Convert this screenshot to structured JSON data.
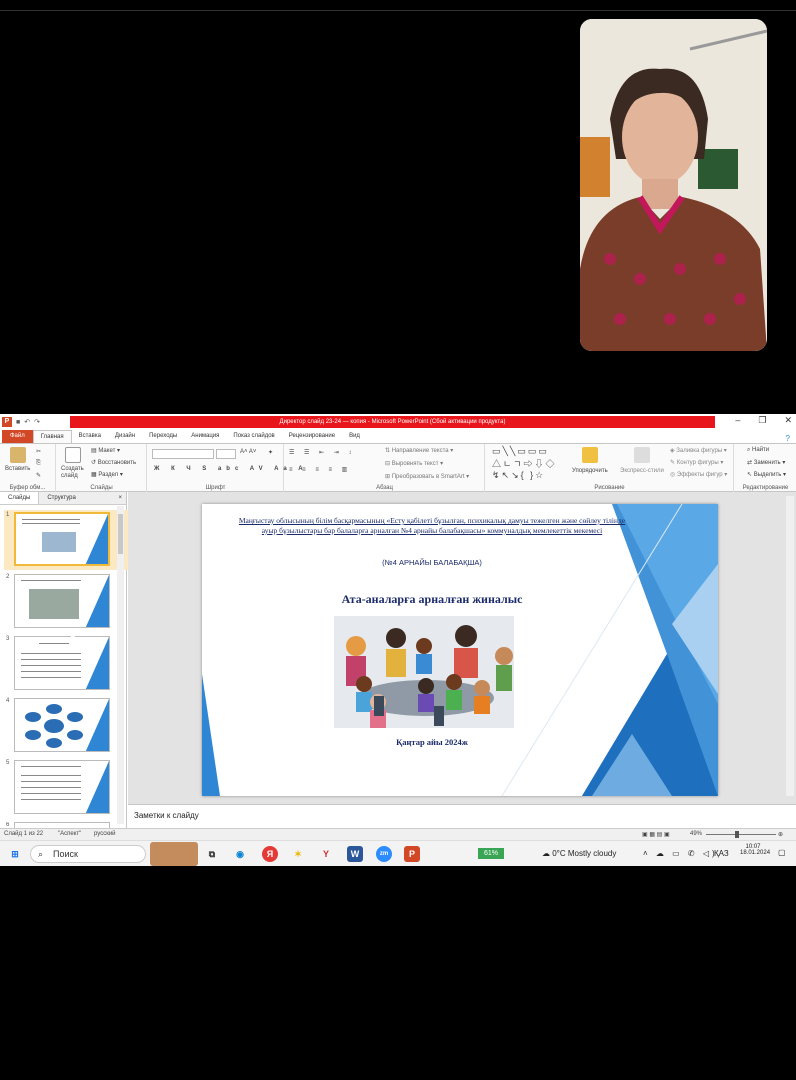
{
  "window": {
    "title": "Директор слайд 23-24 — копия - Microsoft PowerPoint (Сбой активации продукта)",
    "controls": [
      "–",
      "❐",
      "✕"
    ]
  },
  "ribbon_tabs": [
    "Файл",
    "Главная",
    "Вставка",
    "Дизайн",
    "Переходы",
    "Анимация",
    "Показ слайдов",
    "Рецензирование",
    "Вид"
  ],
  "ribbon": {
    "clipboard": {
      "label": "Буфер обм...",
      "paste": "Вставить"
    },
    "slides": {
      "label": "Слайды",
      "new_slide": "Создать слайд",
      "layout": "Макет",
      "reset": "Восстановить",
      "section": "Раздел"
    },
    "font": {
      "label": "Шрифт"
    },
    "paragraph": {
      "label": "Абзац",
      "text_direction": "Направление текста",
      "align_text": "Выровнять текст",
      "smartart": "Преобразовать в SmartArt"
    },
    "drawing": {
      "label": "Рисование",
      "arrange": "Упорядочить",
      "quick_styles": "Экспресс-стили",
      "shape_fill": "Заливка фигуры",
      "shape_outline": "Контур фигуры",
      "shape_effects": "Эффекты фигур"
    },
    "editing": {
      "label": "Редактирование",
      "find": "Найти",
      "replace": "Заменить",
      "select": "Выделить"
    }
  },
  "pane_tabs": {
    "slides": "Слайды",
    "outline": "Структура"
  },
  "thumbnails": [
    "1",
    "2",
    "3",
    "4",
    "5",
    "6"
  ],
  "slide": {
    "header": "Маңғыстау облысының білім басқармасының «Есту қабілеті бұзылған, психикалық дамуы тежелген және сөйлеу тілінде ауыр бұзылыстары бар балаларға арналған №4 арнайы балабақшасы» коммуналдық мемлекеттік мекемесі",
    "subheader": "(№4 АРНАЙЫ БАЛАБАҚША)",
    "title": "Ата-аналарға арналған жиналыс",
    "date": "Қаңтар айы 2024ж"
  },
  "notes": {
    "placeholder": "Заметки к слайду"
  },
  "status": {
    "slide_counter": "Слайд 1 из 22",
    "theme": "\"Аспект\"",
    "language": "русский",
    "zoom": "49%"
  },
  "taskbar": {
    "search": "Поиск",
    "battery": "61%",
    "weather": "0°C  Mostly cloudy",
    "lang": "ҚАЗ",
    "time": "10:07",
    "date": "18.01.2024"
  },
  "colors": {
    "accent_red": "#e8151b",
    "file_tab": "#d24726",
    "slide_blue": "#2e86d4"
  }
}
